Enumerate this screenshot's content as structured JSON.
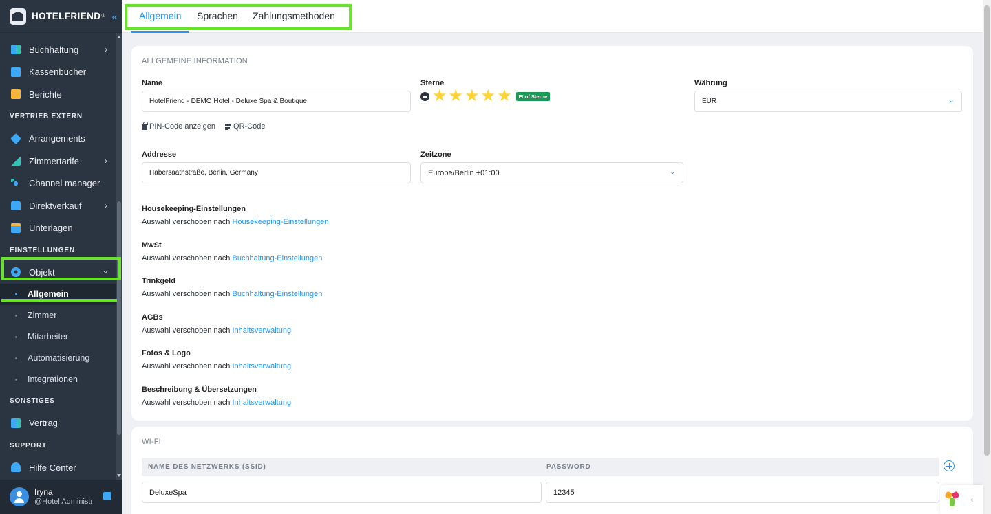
{
  "brand": {
    "name": "HOTELFRIEND",
    "reg": "®"
  },
  "sidebar": {
    "items": [
      {
        "label": "Buchhaltung",
        "icon": "grid-icon",
        "chevron": true
      },
      {
        "label": "Kassenbücher",
        "icon": "book-icon"
      },
      {
        "label": "Berichte",
        "icon": "clipboard-icon"
      }
    ],
    "section_vertrieb": "VERTRIEB EXTERN",
    "items_vertrieb": [
      {
        "label": "Arrangements",
        "icon": "tag-icon"
      },
      {
        "label": "Zimmertarife",
        "icon": "chart-icon",
        "chevron": true
      },
      {
        "label": "Channel manager",
        "icon": "network-icon"
      },
      {
        "label": "Direktverkauf",
        "icon": "phone-icon",
        "chevron": true
      },
      {
        "label": "Unterlagen",
        "icon": "folder-icon"
      }
    ],
    "section_einstellungen": "EINSTELLUNGEN",
    "objekt": {
      "label": "Objekt",
      "icon": "gear-icon"
    },
    "sub_items": [
      "Allgemein",
      "Zimmer",
      "Mitarbeiter",
      "Automatisierung",
      "Integrationen"
    ],
    "section_sonstiges": "SONSTIGES",
    "vertrag": {
      "label": "Vertrag",
      "icon": "document-icon"
    },
    "section_support": "SUPPORT",
    "hilfe": {
      "label": "Hilfe Center",
      "icon": "help-icon"
    }
  },
  "user": {
    "name": "Iryna",
    "role": "@Hotel Administr"
  },
  "tabs": [
    "Allgemein",
    "Sprachen",
    "Zahlungsmethoden"
  ],
  "general": {
    "section_title": "ALLGEMEINE INFORMATION",
    "name_label": "Name",
    "name_value": "HotelFriend - DEMO Hotel - Deluxe Spa & Boutique",
    "stars_label": "Sterne",
    "stars_value": 5,
    "stars_badge": "Fünf Sterne",
    "currency_label": "Währung",
    "currency_value": "EUR",
    "pin_link": "PIN-Code anzeigen",
    "qr_link": "QR-Code",
    "address_label": "Addresse",
    "address_value": "Habersaathstraße, Berlin, Germany",
    "timezone_label": "Zeitzone",
    "timezone_value": "Europe/Berlin +01:00",
    "settings": [
      {
        "title": "Housekeeping-Einstellungen",
        "text": "Auswahl verschoben nach",
        "link": "Housekeeping-Einstellungen"
      },
      {
        "title": "MwSt",
        "text": "Auswahl verschoben nach",
        "link": "Buchhaltung-Einstellungen"
      },
      {
        "title": "Trinkgeld",
        "text": "Auswahl verschoben nach",
        "link": "Buchhaltung-Einstellungen"
      },
      {
        "title": "AGBs",
        "text": "Auswahl verschoben nach",
        "link": "Inhaltsverwaltung"
      },
      {
        "title": "Fotos & Logo",
        "text": "Auswahl verschoben nach",
        "link": "Inhaltsverwaltung"
      },
      {
        "title": "Beschreibung & Übersetzungen",
        "text": "Auswahl verschoben nach",
        "link": "Inhaltsverwaltung"
      }
    ]
  },
  "wifi": {
    "section_title": "WI-FI",
    "col_ssid": "NAME DES NETZWERKS (SSID)",
    "col_password": "PASSWORD",
    "rows": [
      {
        "ssid": "DeluxeSpa",
        "password": "12345"
      }
    ]
  },
  "colors": {
    "accent": "#2196f3",
    "sidebar_bg": "#2b3542",
    "highlight": "#66e32a",
    "badge": "#1a9a56",
    "star": "#ffd331"
  }
}
